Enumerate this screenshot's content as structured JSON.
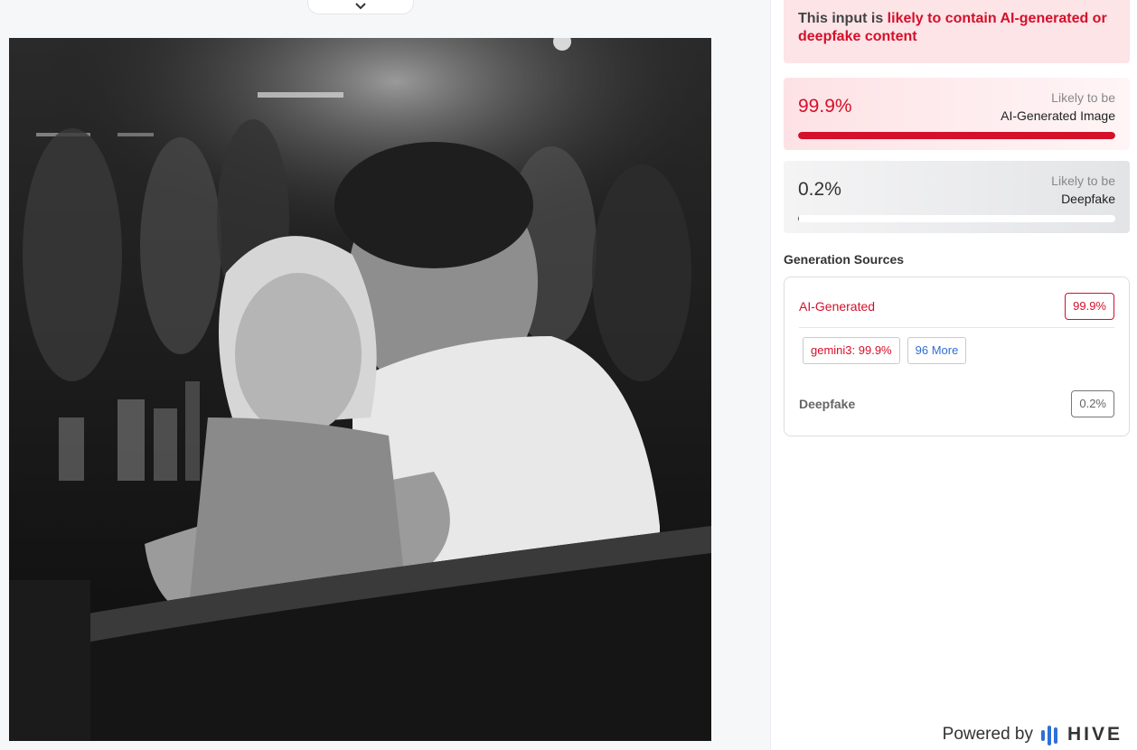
{
  "viewer": {
    "collapse_icon": "chevron-down-icon"
  },
  "banner": {
    "prefix": "This input is ",
    "highlight": "likely to contain AI-generated or deepfake content"
  },
  "scores": {
    "ai": {
      "percent": "99.9%",
      "likely_line1": "Likely to be",
      "likely_line2": "AI-Generated Image",
      "fraction": 0.999,
      "color": "#d4102a"
    },
    "deepfake": {
      "percent": "0.2%",
      "likely_line1": "Likely to be",
      "likely_line2": "Deepfake",
      "fraction": 0.002,
      "color": "#555555"
    }
  },
  "sources": {
    "title": "Generation Sources",
    "ai_label": "AI-Generated",
    "ai_value": "99.9%",
    "model_chip": "gemini3: 99.9%",
    "more_chip": "96 More",
    "deepfake_label": "Deepfake",
    "deepfake_value": "0.2%"
  },
  "footer": {
    "powered_by": "Powered by",
    "brand": "HIVE"
  }
}
